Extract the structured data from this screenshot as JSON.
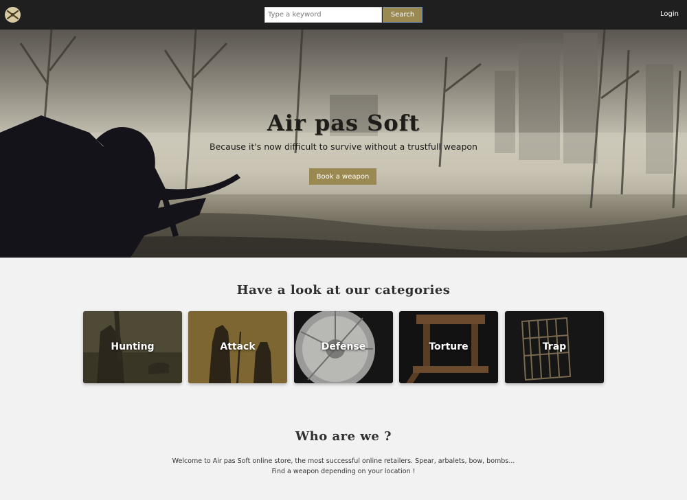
{
  "header": {
    "search": {
      "placeholder": "Type a keyword",
      "value": ""
    },
    "search_button": "Search",
    "login": "Login"
  },
  "hero": {
    "title": "Air pas Soft",
    "subtitle": "Because it's now difficult to survive without a trustfull weapon",
    "cta": "Book a weapon"
  },
  "categories": {
    "title": "Have a look at our categories",
    "items": [
      {
        "label": "Hunting"
      },
      {
        "label": "Attack"
      },
      {
        "label": "Defense"
      },
      {
        "label": "Torture"
      },
      {
        "label": "Trap"
      }
    ]
  },
  "about": {
    "title": "Who are we ?",
    "text": "Welcome to Air pas Soft online store, the most successful online retailers. Spear, arbalets, bow, bombs... Find a weapon depending on your location !"
  },
  "colors": {
    "nav_bg": "#1f1f1f",
    "accent": "#9a8a52",
    "page_bg": "#f2f2f2"
  }
}
